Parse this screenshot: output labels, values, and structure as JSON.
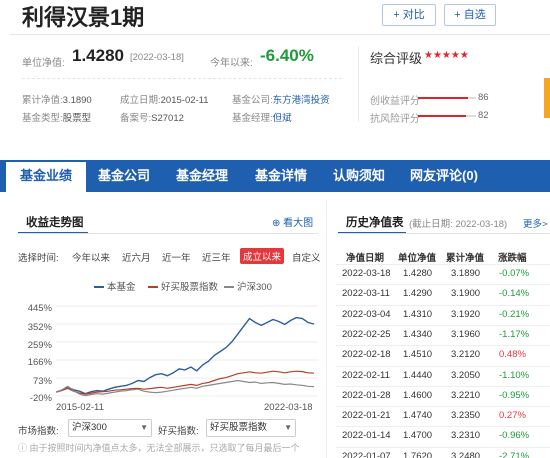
{
  "header": {
    "fund_name": "利得汉景1期",
    "compare_label": "+ 对比",
    "select_label": "+ 自选"
  },
  "nav": {
    "unit_label": "单位净值:",
    "unit_value": "1.4280",
    "date": "[2022-03-18]",
    "ytd_label": "今年以来:",
    "ytd_value": "-6.40%"
  },
  "info": {
    "cum_label": "累计净值:",
    "cum_value": "3.1890",
    "est_label": "成立日期:",
    "est_value": "2015-02-11",
    "co_label": "基金公司:",
    "co_value": "东方港湾投资",
    "type_label": "基金类型:",
    "type_value": "股票型",
    "rec_label": "备案号:",
    "rec_value": "S27012",
    "mgr_label": "基金经理:",
    "mgr_value": "但斌"
  },
  "rating": {
    "title": "综合评级",
    "stars": "★★★★★",
    "items": [
      {
        "label": "创收益评分",
        "value": "86",
        "score": 86
      },
      {
        "label": "抗风险评分",
        "value": "82",
        "score": 82
      }
    ]
  },
  "tabs": [
    "基金业绩",
    "基金公司",
    "基金经理",
    "基金详情",
    "认购须知",
    "网友评论(0)"
  ],
  "trend": {
    "title": "收益走势图",
    "zoom": "看大图",
    "range_label": "选择时间:",
    "ranges": [
      "今年以来",
      "近六月",
      "近一年",
      "近三年",
      "成立以来",
      "自定义"
    ],
    "active_range": "成立以来",
    "legend": [
      {
        "name": "本基金",
        "color": "#2c5e9e"
      },
      {
        "name": "好买股票指数",
        "color": "#b5412a"
      },
      {
        "name": "沪深300",
        "color": "#888888"
      }
    ],
    "index_label": "市场指数:",
    "index_value": "沪深300",
    "haomai_label": "好买指数:",
    "haomai_value": "好买股票指数",
    "note": "由于按照时间内净值点太多，无法全部展示，只选取了每月最后一个"
  },
  "chart_data": {
    "type": "line",
    "yticks": [
      "445%",
      "352%",
      "259%",
      "166%",
      "73%",
      "-20%"
    ],
    "ylim": [
      -20,
      445
    ],
    "x_start": "2015-02-11",
    "x_end": "2022-03-18",
    "series": [
      {
        "name": "本基金",
        "color": "#2c5e9e",
        "values": [
          0,
          10,
          25,
          12,
          5,
          -8,
          2,
          8,
          5,
          15,
          25,
          30,
          35,
          45,
          60,
          55,
          75,
          90,
          95,
          85,
          100,
          120,
          115,
          130,
          110,
          140,
          160,
          190,
          210,
          230,
          260,
          300,
          340,
          380,
          360,
          345,
          360,
          375,
          365,
          350,
          370,
          385,
          380,
          360,
          352
        ]
      },
      {
        "name": "好买股票指数",
        "color": "#b5412a",
        "values": [
          0,
          8,
          20,
          5,
          -5,
          -10,
          -5,
          0,
          2,
          5,
          10,
          12,
          15,
          18,
          20,
          15,
          18,
          22,
          25,
          20,
          25,
          30,
          35,
          40,
          35,
          45,
          50,
          60,
          70,
          75,
          85,
          95,
          100,
          105,
          100,
          98,
          103,
          108,
          105,
          100,
          105,
          108,
          106,
          100,
          98
        ]
      },
      {
        "name": "沪深300",
        "color": "#888888",
        "values": [
          0,
          12,
          30,
          8,
          -10,
          -18,
          -12,
          -8,
          -10,
          -5,
          0,
          5,
          8,
          12,
          15,
          5,
          0,
          -3,
          0,
          5,
          10,
          15,
          20,
          25,
          20,
          30,
          35,
          40,
          45,
          50,
          55,
          60,
          55,
          50,
          52,
          45,
          48,
          50,
          45,
          40,
          42,
          38,
          35,
          30,
          28
        ]
      }
    ]
  },
  "history": {
    "title": "历史净值表",
    "date_note": "(截止日期: 2022-03-18)",
    "more": "更多>",
    "headers": [
      "净值日期",
      "单位净值",
      "累计净值",
      "涨跌幅"
    ],
    "rows": [
      {
        "date": "2022-03-18",
        "unit": "1.4280",
        "cum": "3.1890",
        "chg": "-0.07%",
        "dir": "down"
      },
      {
        "date": "2022-03-11",
        "unit": "1.4290",
        "cum": "3.1900",
        "chg": "-0.14%",
        "dir": "down"
      },
      {
        "date": "2022-03-04",
        "unit": "1.4310",
        "cum": "3.1920",
        "chg": "-0.21%",
        "dir": "down"
      },
      {
        "date": "2022-02-25",
        "unit": "1.4340",
        "cum": "3.1960",
        "chg": "-1.17%",
        "dir": "down"
      },
      {
        "date": "2022-02-18",
        "unit": "1.4510",
        "cum": "3.2120",
        "chg": "0.48%",
        "dir": "up"
      },
      {
        "date": "2022-02-11",
        "unit": "1.4440",
        "cum": "3.2050",
        "chg": "-1.10%",
        "dir": "down"
      },
      {
        "date": "2022-01-28",
        "unit": "1.4600",
        "cum": "3.2210",
        "chg": "-0.95%",
        "dir": "down"
      },
      {
        "date": "2022-01-21",
        "unit": "1.4740",
        "cum": "3.2350",
        "chg": "0.27%",
        "dir": "up"
      },
      {
        "date": "2022-01-14",
        "unit": "1.4700",
        "cum": "3.2310",
        "chg": "-0.96%",
        "dir": "down"
      },
      {
        "date": "2022-01-07",
        "unit": "1.7620",
        "cum": "3.2480",
        "chg": "-2.71%",
        "dir": "down"
      }
    ]
  }
}
